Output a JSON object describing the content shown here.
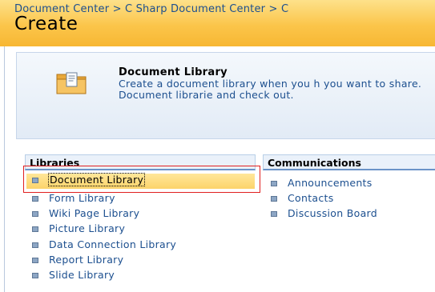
{
  "header": {
    "breadcrumb": "Document Center > C Sharp Document Center > C",
    "title": "Create"
  },
  "description": {
    "icon": "document-library-icon",
    "title": "Document Library",
    "text": "Create a document library when you h you want to share.  Document librarie and check out."
  },
  "libraries": {
    "heading": "Libraries",
    "items": [
      {
        "label": "Document Library"
      },
      {
        "label": "Form Library"
      },
      {
        "label": "Wiki Page Library"
      },
      {
        "label": "Picture Library"
      },
      {
        "label": "Data Connection Library"
      },
      {
        "label": "Report Library"
      },
      {
        "label": "Slide Library"
      }
    ],
    "selected": "Document Library"
  },
  "communications": {
    "heading": "Communications",
    "items": [
      {
        "label": "Announcements"
      },
      {
        "label": "Contacts"
      },
      {
        "label": "Discussion Board"
      }
    ]
  },
  "colors": {
    "header": "#fbc54a",
    "link": "#1c4f8f",
    "selection": "#fcd36a",
    "annotation": "#e02020"
  }
}
